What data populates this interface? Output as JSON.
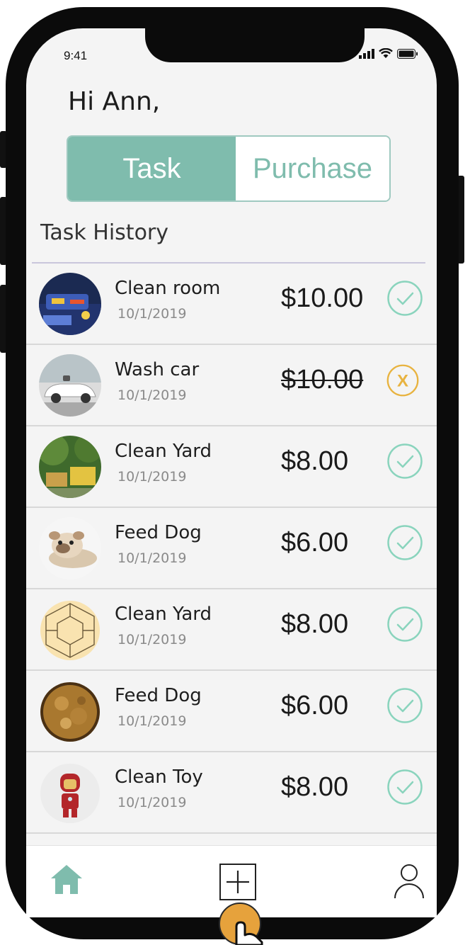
{
  "status_bar": {
    "time": "9:41"
  },
  "greeting": "Hi Ann,",
  "segmented": {
    "task": "Task",
    "purchase": "Purchase"
  },
  "section_title": "Task History",
  "tasks": [
    {
      "name": "Clean room",
      "date": "10/1/2019",
      "price": "$10.00",
      "status": "completed"
    },
    {
      "name": "Wash car",
      "date": "10/1/2019",
      "price": "$10.00",
      "status": "cancelled",
      "cancel_label": "X"
    },
    {
      "name": "Clean Yard",
      "date": "10/1/2019",
      "price": "$8.00",
      "status": "completed"
    },
    {
      "name": "Feed Dog",
      "date": "10/1/2019",
      "price": "$6.00",
      "status": "completed"
    },
    {
      "name": "Clean Yard",
      "date": "10/1/2019",
      "price": "$8.00",
      "status": "completed"
    },
    {
      "name": "Feed Dog",
      "date": "10/1/2019",
      "price": "$6.00",
      "status": "completed"
    },
    {
      "name": "Clean Toy",
      "date": "10/1/2019",
      "price": "$8.00",
      "status": "completed"
    }
  ],
  "tab_bar": {
    "items": [
      "home-icon",
      "add-icon",
      "profile-icon"
    ]
  },
  "colors": {
    "accent": "#7fbcad",
    "check": "#8ad4bd",
    "cancel": "#e8b340",
    "cursor": "#e6a23c"
  }
}
